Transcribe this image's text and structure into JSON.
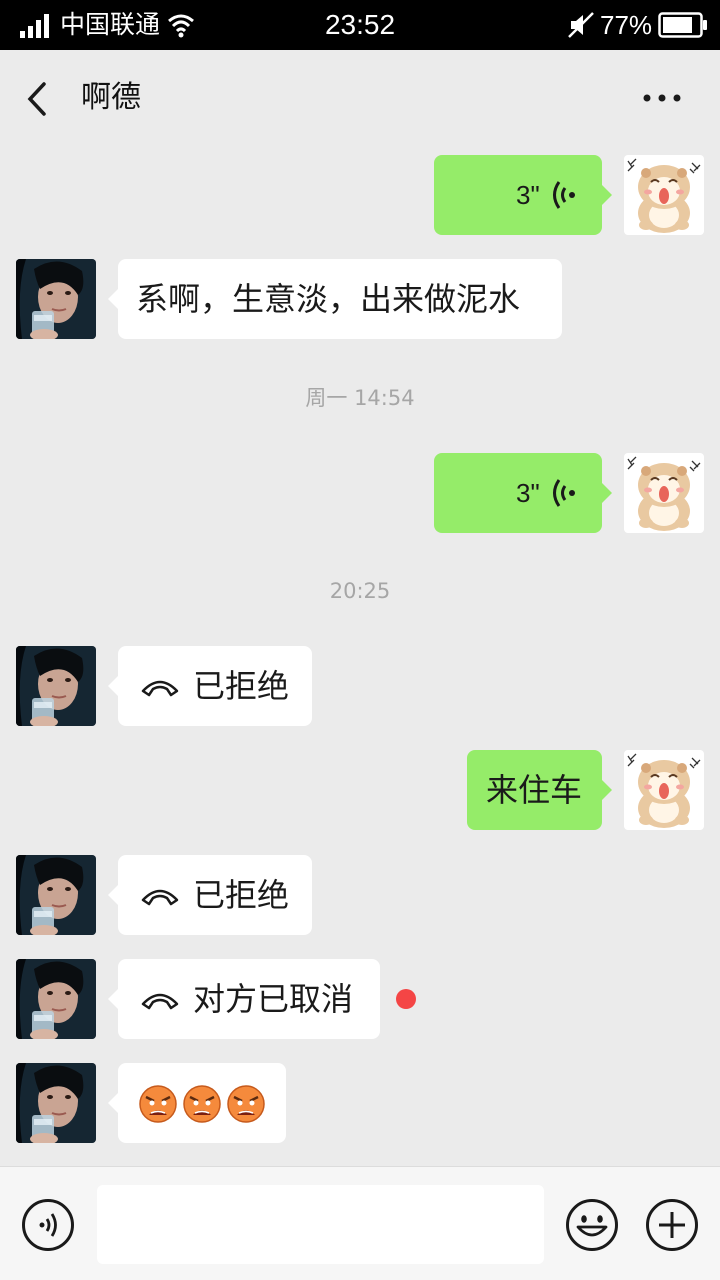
{
  "status_bar": {
    "carrier": "中国联通",
    "time": "23:52",
    "battery": "77%"
  },
  "nav": {
    "title": "啊德"
  },
  "messages": [
    {
      "side": "right",
      "type": "voice",
      "text": "3\""
    },
    {
      "side": "left",
      "type": "text",
      "text": "系啊，生意淡，出来做泥水"
    },
    {
      "side": "center",
      "type": "time",
      "text": "周一 14:54"
    },
    {
      "side": "right",
      "type": "voice",
      "text": "3\""
    },
    {
      "side": "center",
      "type": "time",
      "text": "20:25"
    },
    {
      "side": "left",
      "type": "call",
      "text": "已拒绝"
    },
    {
      "side": "right",
      "type": "text",
      "text": "来住车"
    },
    {
      "side": "left",
      "type": "call",
      "text": "已拒绝"
    },
    {
      "side": "left",
      "type": "call",
      "text": "对方已取消",
      "unread": true
    },
    {
      "side": "left",
      "type": "emoji",
      "emoji": "angry-face-icon",
      "count": 3
    }
  ],
  "input": {
    "placeholder": ""
  },
  "colors": {
    "my_bubble": "#95ec69",
    "their_bubble": "#ffffff",
    "background": "#ebebeb",
    "unread_dot": "#f44545"
  }
}
